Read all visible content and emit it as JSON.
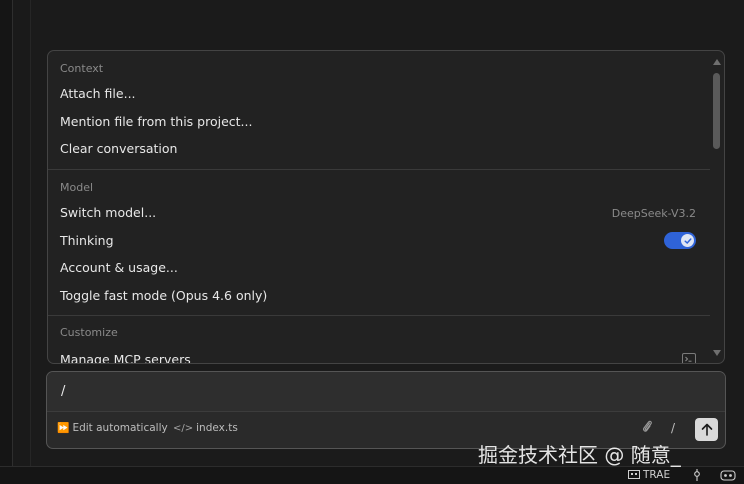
{
  "menu": {
    "sections": [
      {
        "title": "Context",
        "items": [
          {
            "label": "Attach file..."
          },
          {
            "label": "Mention file from this project..."
          },
          {
            "label": "Clear conversation"
          }
        ]
      },
      {
        "title": "Model",
        "items": [
          {
            "label": "Switch model...",
            "value": "DeepSeek-V3.2"
          },
          {
            "label": "Thinking",
            "toggle_on": true
          },
          {
            "label": "Account & usage..."
          },
          {
            "label": "Toggle fast mode (Opus 4.6 only)"
          }
        ]
      },
      {
        "title": "Customize",
        "items": [
          {
            "label": "Manage MCP servers"
          }
        ]
      }
    ]
  },
  "composer": {
    "input_value": "/",
    "mode_label": "Edit automatically",
    "file_label": "index.ts",
    "slash_label": "/"
  },
  "statusbar": {
    "trae_label": "TRAE"
  },
  "watermark": "掘金技术社区 @ 随意_",
  "colors": {
    "accent": "#2f63d8",
    "background": "#1b1b1b",
    "panel": "#222222"
  },
  "icons": [
    "scroll-up-icon",
    "scroll-down-icon",
    "terminal-icon",
    "fast-forward-icon",
    "code-icon",
    "paperclip-icon",
    "arrow-up-icon",
    "trae-icon",
    "branch-icon",
    "copilot-icon",
    "check-icon"
  ]
}
